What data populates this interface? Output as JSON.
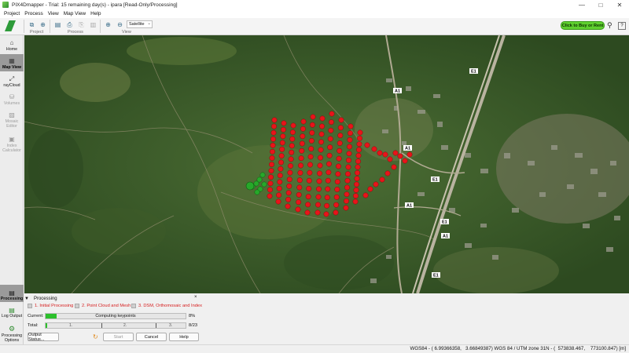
{
  "window": {
    "title": "PIX4Dmapper - Trial: 15 remaining day(s) - ipara [Read-Only/Processing]",
    "controls": [
      "—",
      "□",
      "✕"
    ]
  },
  "menu": [
    "Project",
    "Process",
    "View",
    "Map View",
    "Help"
  ],
  "toolbar": {
    "groups": [
      "Project",
      "Process",
      "View"
    ],
    "basemap": "Satellite",
    "buy_label": "Click to Buy or Rent"
  },
  "sidebar": {
    "items": [
      {
        "label": "Home",
        "icon": "home-icon",
        "state": "normal"
      },
      {
        "label": "Map View",
        "icon": "map-view-icon",
        "state": "active"
      },
      {
        "label": "rayCloud",
        "icon": "raycloud-icon",
        "state": "normal"
      },
      {
        "label": "Volumes",
        "icon": "volumes-icon",
        "state": "disabled"
      },
      {
        "label": "Mosaic Editor",
        "icon": "mosaic-editor-icon",
        "state": "disabled"
      },
      {
        "label": "Index Calculator",
        "icon": "index-calculator-icon",
        "state": "disabled"
      }
    ],
    "bottom": [
      {
        "label": "Processing",
        "icon": "processing-icon"
      },
      {
        "label": "Log Output",
        "icon": "log-output-icon"
      },
      {
        "label": "Processing Options",
        "icon": "gear-icon"
      }
    ]
  },
  "map": {
    "road_labels": [
      "E1",
      "A1",
      "A1",
      "E1",
      "A1",
      "E1",
      "A1",
      "E1"
    ],
    "colors": {
      "flight_done": "#e8141a",
      "flight_current": "#27a82a"
    }
  },
  "processing": {
    "title": "Processing",
    "close": "×",
    "steps": [
      "1. Initial Processing",
      "2. Point Cloud and Mesh",
      "3. DSM, Orthomosaic and Index"
    ],
    "current_label": "Current:",
    "current_status": "Computing keypoints",
    "current_progress": 0.08,
    "current_percent": "8%",
    "total_label": "Total:",
    "total_segments": [
      "1.",
      "2.",
      "3."
    ],
    "total_count": "8/23",
    "buttons": {
      "output_status": "Output Status...",
      "start": "Start",
      "cancel": "Cancel",
      "help": "Help"
    }
  },
  "status": {
    "text": "WGS84 - ( 6.99366358,   3.66849387) WGS 84 / UTM zone 31N - (  573838.467,    773100.847) [m]"
  }
}
